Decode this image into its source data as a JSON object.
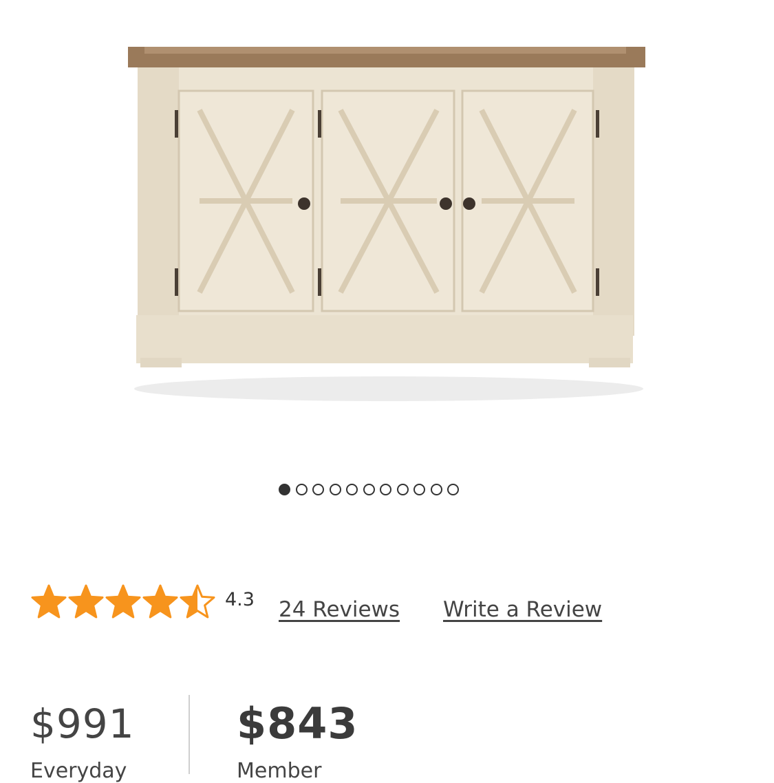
{
  "product": {
    "image_alt": "cream sideboard with wood top"
  },
  "carousel": {
    "total": 11,
    "active_index": 0
  },
  "rating": {
    "value": "4.3",
    "stars": 4.3,
    "star_color": "#F7941D",
    "reviews_label": "24 Reviews",
    "write_review_label": "Write a Review"
  },
  "price": {
    "everyday": "$991",
    "everyday_label": "Everyday",
    "member": "$843",
    "member_label": "Member"
  }
}
